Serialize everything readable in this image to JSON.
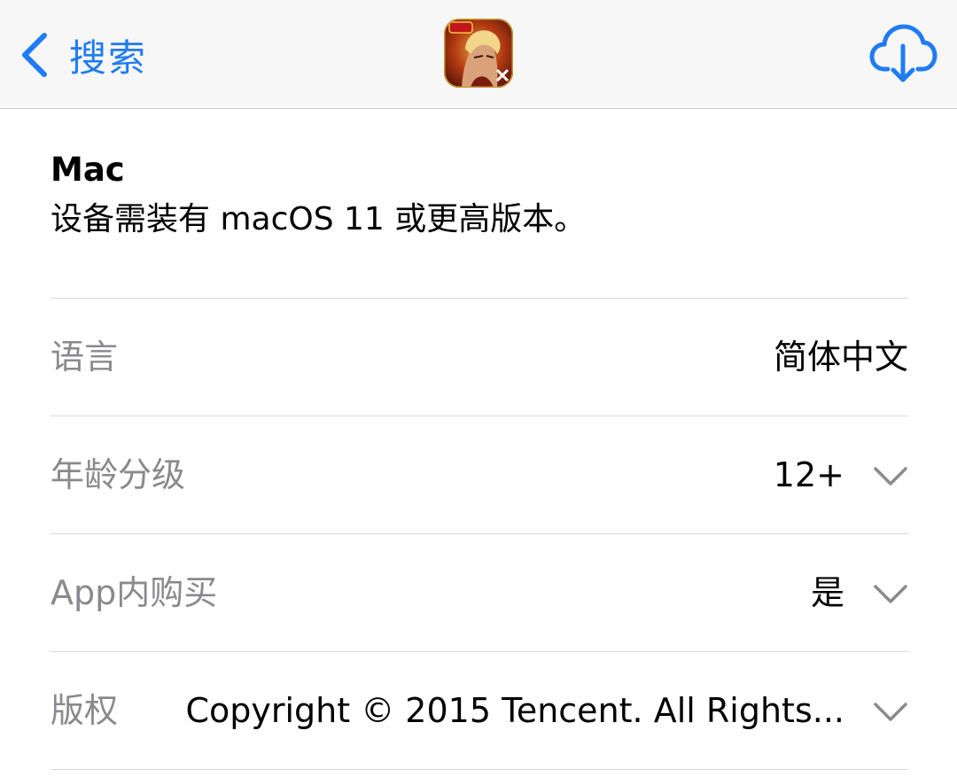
{
  "nav": {
    "back_label": "搜索",
    "back_icon": "chevron-left-icon",
    "app_icon": "app-icon",
    "download_icon": "cloud-download-icon",
    "accent": "#1f7cf3"
  },
  "compatibility": {
    "title": "Mac",
    "description": "设备需装有 macOS 11 或更高版本。"
  },
  "info_rows": [
    {
      "label": "语言",
      "value": "简体中文",
      "expandable": false
    },
    {
      "label": "年龄分级",
      "value": "12+",
      "expandable": true
    },
    {
      "label": "App内购买",
      "value": "是",
      "expandable": true
    },
    {
      "label": "版权",
      "value": "Copyright ©  2015 Tencent. All Rights...",
      "expandable": true
    }
  ]
}
